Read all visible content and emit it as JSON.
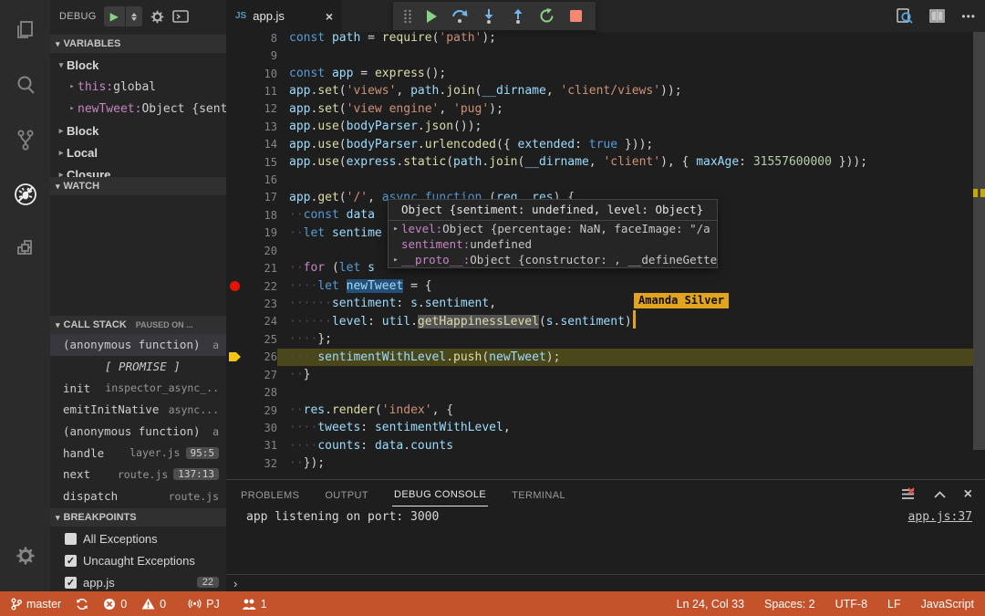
{
  "activity_bar": {
    "icons": [
      {
        "name": "files-icon"
      },
      {
        "name": "search-icon"
      },
      {
        "name": "source-control-icon"
      },
      {
        "name": "debug-icon",
        "active": true
      },
      {
        "name": "extensions-icon"
      }
    ],
    "settings_icon": "gear-icon"
  },
  "glyphs": {
    "close": "×",
    "twisty_open": "▾",
    "twisty_closed": "▸",
    "check": "✓",
    "play": "▶",
    "ellipsis": "•••"
  },
  "sidebar": {
    "debug_toolbar": {
      "label": "DEBUG"
    },
    "sections": {
      "variables": {
        "title": "VARIABLES"
      },
      "watch": {
        "title": "WATCH"
      },
      "call_stack": {
        "title": "CALL STACK",
        "status": "PAUSED ON ..."
      },
      "breakpoints": {
        "title": "BREAKPOINTS"
      }
    },
    "variables_rows": [
      {
        "kind": "scope",
        "label": "Block",
        "expanded": true
      },
      {
        "kind": "var",
        "name": "this",
        "value": "global"
      },
      {
        "kind": "var",
        "name": "newTweet",
        "value": "Object {sent…"
      },
      {
        "kind": "scope",
        "label": "Block",
        "expanded": false
      },
      {
        "kind": "scope",
        "label": "Local",
        "expanded": false
      },
      {
        "kind": "scope",
        "label": "Closure",
        "expanded": false
      }
    ],
    "call_stack_frames": [
      {
        "name": "(anonymous function)",
        "file": "a",
        "selected": true
      },
      {
        "name": "[ PROMISE ]",
        "promise": true
      },
      {
        "name": "init",
        "file": "inspector_async_.."
      },
      {
        "name": "emitInitNative",
        "file": "async..."
      },
      {
        "name": "(anonymous function)",
        "file": "a"
      },
      {
        "name": "handle",
        "file": "layer.js",
        "badge": "95:5"
      },
      {
        "name": "next",
        "file": "route.js",
        "badge": "137:13"
      },
      {
        "name": "dispatch",
        "file": "route.js"
      }
    ],
    "breakpoints_rows": [
      {
        "label": "All Exceptions",
        "checked": false
      },
      {
        "label": "Uncaught Exceptions",
        "checked": true
      },
      {
        "label": "app.js",
        "checked": true,
        "badge": "22"
      }
    ]
  },
  "editor": {
    "tab": {
      "icon": "JS",
      "label": "app.js"
    },
    "breakpoint_line": 22,
    "current_line": 26,
    "lines": [
      {
        "n": 8,
        "t": [
          [
            "const",
            "kw"
          ],
          [
            " ",
            "pun"
          ],
          [
            "path",
            "var"
          ],
          [
            " = ",
            "pun"
          ],
          [
            "require",
            "fn"
          ],
          [
            "(",
            "pun"
          ],
          [
            "'path'",
            "str"
          ],
          [
            ");",
            "pun"
          ]
        ]
      },
      {
        "n": 9,
        "t": []
      },
      {
        "n": 10,
        "t": [
          [
            "const",
            "kw"
          ],
          [
            " ",
            "pun"
          ],
          [
            "app",
            "var"
          ],
          [
            " = ",
            "pun"
          ],
          [
            "express",
            "fn"
          ],
          [
            "();",
            "pun"
          ]
        ]
      },
      {
        "n": 11,
        "t": [
          [
            "app",
            "var"
          ],
          [
            ".",
            "pun"
          ],
          [
            "set",
            "fn"
          ],
          [
            "(",
            "pun"
          ],
          [
            "'views'",
            "str"
          ],
          [
            ", ",
            "pun"
          ],
          [
            "path",
            "var"
          ],
          [
            ".",
            "pun"
          ],
          [
            "join",
            "fn"
          ],
          [
            "(",
            "pun"
          ],
          [
            "__dirname",
            "var"
          ],
          [
            ", ",
            "pun"
          ],
          [
            "'client/views'",
            "str"
          ],
          [
            "));",
            "pun"
          ]
        ]
      },
      {
        "n": 12,
        "t": [
          [
            "app",
            "var"
          ],
          [
            ".",
            "pun"
          ],
          [
            "set",
            "fn"
          ],
          [
            "(",
            "pun"
          ],
          [
            "'view engine'",
            "str"
          ],
          [
            ", ",
            "pun"
          ],
          [
            "'pug'",
            "str"
          ],
          [
            ");",
            "pun"
          ]
        ]
      },
      {
        "n": 13,
        "t": [
          [
            "app",
            "var"
          ],
          [
            ".",
            "pun"
          ],
          [
            "use",
            "fn"
          ],
          [
            "(",
            "pun"
          ],
          [
            "bodyParser",
            "var"
          ],
          [
            ".",
            "pun"
          ],
          [
            "json",
            "fn"
          ],
          [
            "());",
            "pun"
          ]
        ]
      },
      {
        "n": 14,
        "t": [
          [
            "app",
            "var"
          ],
          [
            ".",
            "pun"
          ],
          [
            "use",
            "fn"
          ],
          [
            "(",
            "pun"
          ],
          [
            "bodyParser",
            "var"
          ],
          [
            ".",
            "pun"
          ],
          [
            "urlencoded",
            "fn"
          ],
          [
            "({ ",
            "pun"
          ],
          [
            "extended",
            "var"
          ],
          [
            ": ",
            "pun"
          ],
          [
            "true",
            "kw"
          ],
          [
            " }));",
            "pun"
          ]
        ]
      },
      {
        "n": 15,
        "t": [
          [
            "app",
            "var"
          ],
          [
            ".",
            "pun"
          ],
          [
            "use",
            "fn"
          ],
          [
            "(",
            "pun"
          ],
          [
            "express",
            "var"
          ],
          [
            ".",
            "pun"
          ],
          [
            "static",
            "fn"
          ],
          [
            "(",
            "pun"
          ],
          [
            "path",
            "var"
          ],
          [
            ".",
            "pun"
          ],
          [
            "join",
            "fn"
          ],
          [
            "(",
            "pun"
          ],
          [
            "__dirname",
            "var"
          ],
          [
            ", ",
            "pun"
          ],
          [
            "'client'",
            "str"
          ],
          [
            "), { ",
            "pun"
          ],
          [
            "maxAge",
            "var"
          ],
          [
            ": ",
            "pun"
          ],
          [
            "31557600000",
            "num"
          ],
          [
            " }));",
            "pun"
          ]
        ]
      },
      {
        "n": 16,
        "t": []
      },
      {
        "n": 17,
        "t": [
          [
            "app",
            "var"
          ],
          [
            ".",
            "pun"
          ],
          [
            "get",
            "fn"
          ],
          [
            "(",
            "pun"
          ],
          [
            "'/'",
            "str"
          ],
          [
            ", ",
            "pun"
          ],
          [
            "async",
            "kw"
          ],
          [
            " ",
            "pun"
          ],
          [
            "function",
            "kw"
          ],
          [
            " (",
            "pun"
          ],
          [
            "req",
            "var"
          ],
          [
            ", ",
            "pun"
          ],
          [
            "res",
            "var"
          ],
          [
            ") {",
            "pun"
          ]
        ]
      },
      {
        "n": 18,
        "t": [
          [
            "··",
            "ws"
          ],
          [
            "const",
            "kw"
          ],
          [
            " ",
            "pun"
          ],
          [
            "data",
            "var"
          ]
        ]
      },
      {
        "n": 19,
        "t": [
          [
            "··",
            "ws"
          ],
          [
            "let",
            "kw"
          ],
          [
            " ",
            "pun"
          ],
          [
            "sentime",
            "var"
          ]
        ]
      },
      {
        "n": 20,
        "t": []
      },
      {
        "n": 21,
        "t": [
          [
            "··",
            "ws"
          ],
          [
            "for",
            "ctrl"
          ],
          [
            " (",
            "pun"
          ],
          [
            "let",
            "kw"
          ],
          [
            " ",
            "pun"
          ],
          [
            "s",
            "var"
          ]
        ]
      },
      {
        "n": 22,
        "t": [
          [
            "····",
            "ws"
          ],
          [
            "let",
            "kw"
          ],
          [
            " ",
            "pun"
          ],
          [
            "newTweet",
            "var",
            "sel"
          ],
          [
            " = {",
            "pun"
          ]
        ]
      },
      {
        "n": 23,
        "t": [
          [
            "······",
            "ws"
          ],
          [
            "sentiment",
            "var"
          ],
          [
            ": ",
            "pun"
          ],
          [
            "s",
            "var"
          ],
          [
            ".",
            "pun"
          ],
          [
            "sentiment",
            "var"
          ],
          [
            ",",
            "pun"
          ]
        ]
      },
      {
        "n": 24,
        "t": [
          [
            "······",
            "ws"
          ],
          [
            "level",
            "var"
          ],
          [
            ": ",
            "pun"
          ],
          [
            "util",
            "var"
          ],
          [
            ".",
            "pun"
          ],
          [
            "getHappinessLevel",
            "fn",
            "box"
          ],
          [
            "(",
            "pun"
          ],
          [
            "s",
            "var"
          ],
          [
            ".",
            "pun"
          ],
          [
            "sentiment",
            "var"
          ],
          [
            ")",
            "pun"
          ]
        ]
      },
      {
        "n": 25,
        "t": [
          [
            "····",
            "ws"
          ],
          [
            "};",
            "pun"
          ]
        ]
      },
      {
        "n": 26,
        "t": [
          [
            "····",
            "ws"
          ],
          [
            "sentimentWithLevel",
            "var"
          ],
          [
            ".",
            "pun"
          ],
          [
            "push",
            "fn"
          ],
          [
            "(",
            "pun"
          ],
          [
            "newTweet",
            "var"
          ],
          [
            ");",
            "pun"
          ]
        ]
      },
      {
        "n": 27,
        "t": [
          [
            "··",
            "ws"
          ],
          [
            "}",
            "pun"
          ]
        ]
      },
      {
        "n": 28,
        "t": []
      },
      {
        "n": 29,
        "t": [
          [
            "··",
            "ws"
          ],
          [
            "res",
            "var"
          ],
          [
            ".",
            "pun"
          ],
          [
            "render",
            "fn"
          ],
          [
            "(",
            "pun"
          ],
          [
            "'index'",
            "str"
          ],
          [
            ", {",
            "pun"
          ]
        ]
      },
      {
        "n": 30,
        "t": [
          [
            "····",
            "ws"
          ],
          [
            "tweets",
            "var"
          ],
          [
            ": ",
            "pun"
          ],
          [
            "sentimentWithLevel",
            "var"
          ],
          [
            ",",
            "pun"
          ]
        ]
      },
      {
        "n": 31,
        "t": [
          [
            "····",
            "ws"
          ],
          [
            "counts",
            "var"
          ],
          [
            ": ",
            "pun"
          ],
          [
            "data",
            "var"
          ],
          [
            ".",
            "pun"
          ],
          [
            "counts",
            "var"
          ]
        ]
      },
      {
        "n": 32,
        "t": [
          [
            "··",
            "ws"
          ],
          [
            "});",
            "pun"
          ]
        ]
      }
    ],
    "hover": {
      "header": "Object {sentiment: undefined, level: Object}",
      "rows": [
        {
          "twisty": true,
          "name": "level",
          "value": "Object {percentage: NaN, faceImage: \"/a"
        },
        {
          "twisty": false,
          "name": "sentiment",
          "value": "undefined"
        },
        {
          "twisty": true,
          "name": "__proto__",
          "value": "Object {constructor: , __defineGette"
        }
      ]
    },
    "collab": {
      "name": "Amanda Silver"
    }
  },
  "panel": {
    "tabs": [
      {
        "label": "PROBLEMS"
      },
      {
        "label": "OUTPUT"
      },
      {
        "label": "DEBUG CONSOLE",
        "active": true
      },
      {
        "label": "TERMINAL"
      }
    ],
    "output": "app listening on port: 3000",
    "source_link": "app.js:37",
    "prompt": "›"
  },
  "status_bar": {
    "branch": "master",
    "errors": "0",
    "warnings": "0",
    "liveshare": "PJ",
    "participants": "1",
    "right_items": [
      "Ln 24, Col 33",
      "Spaces: 2",
      "UTF-8",
      "LF",
      "JavaScript"
    ]
  },
  "colors": {
    "status_bar": "#c4522a",
    "current_line_bg": "#4a481b",
    "breakpoint": "#e51400",
    "collab_tag": "#e3a41d",
    "exec_arrow": "#f5c50e"
  }
}
